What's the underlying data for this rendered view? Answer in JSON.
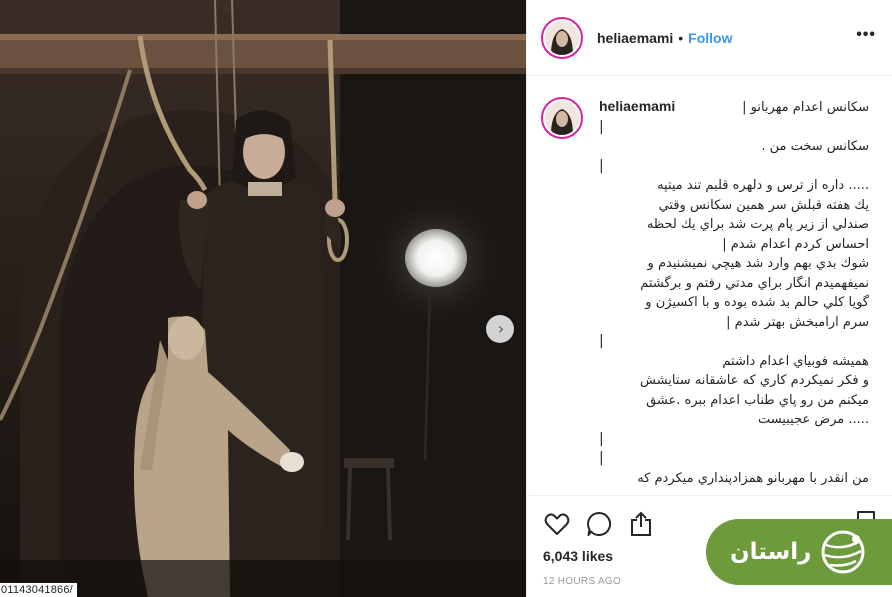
{
  "post": {
    "username": "heliaemami",
    "follow_label": "Follow",
    "dot": "•",
    "more_label": "•••",
    "caption_lines": [
      "سکانس اعدام مهربانو |",
      "|",
      "سکانس سخت من .",
      "|",
      "..... داره از ترس و دلهره قلبم تند میتپه",
      "يك هفته قبلش سر همين سكانس وقتي",
      "صندلي از زير پام پرت شد براي يك لحظه",
      "احساس كردم اعدام شدم |",
      "شوك بدي بهم وارد شد هيچي نميشنيدم و",
      "نميفهميدم انگار براي مدتي رفتم و برگشتم",
      "گويا كلي حالم بد شده بوده و با اكسيژن و",
      "سرم ارامبخش بهتر شدم |",
      "|",
      "هميشه فوبياي اعدام داشتم",
      "و فكر نميكردم كاري كه عاشقانه ستايشش",
      "ميكنم من رو پاي طناب اعدام ببره .عشق",
      "..... مرض عجيبيست",
      "|",
      "|",
      "من انقدر با مهربانو همزادپنداري ميكردم كه"
    ],
    "likes": "6,043 likes",
    "timestamp": "12 HOURS AGO"
  },
  "media": {
    "overlay_id": "01143041866/",
    "next_icon": "chevron-right-icon"
  },
  "actions": {
    "icons": [
      "heart-icon",
      "comment-icon",
      "share-icon",
      "bookmark-icon"
    ]
  },
  "watermark": {
    "brand_text": "راستان",
    "logo_icon": "tennis-ball-logo",
    "color": "#6d9a3a"
  },
  "colors": {
    "link": "#3897f0",
    "text": "#262626",
    "muted": "#999999",
    "avatar_ring": "#d6249f"
  }
}
